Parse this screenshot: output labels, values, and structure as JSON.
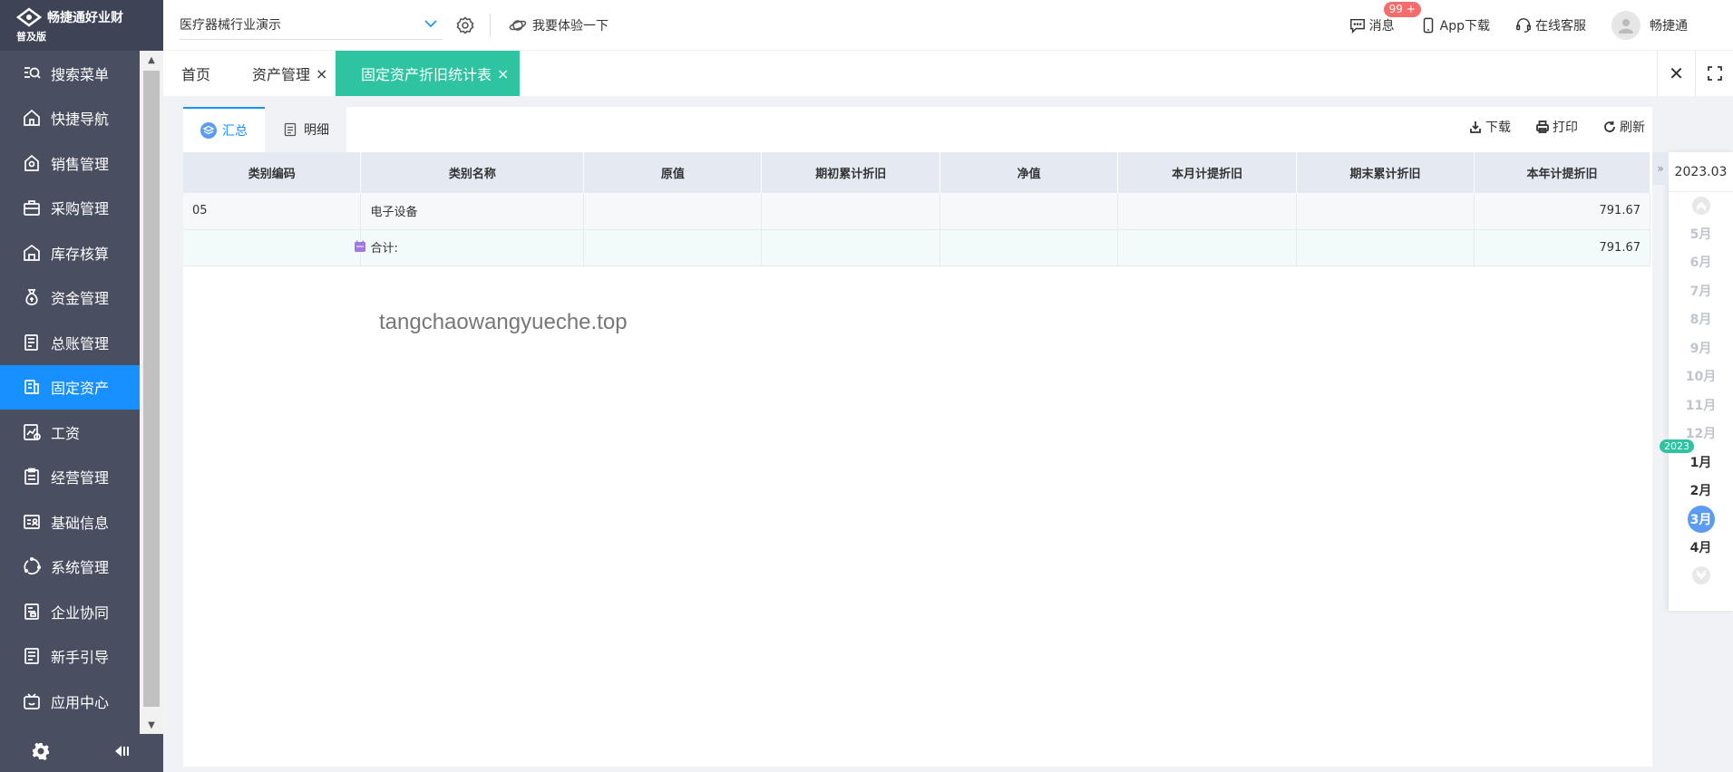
{
  "sidebar": {
    "brand": "畅捷通好业财",
    "edition": "普及版",
    "items": [
      {
        "label": "搜索菜单",
        "icon": "search-menu-icon"
      },
      {
        "label": "快捷导航",
        "icon": "home-icon"
      },
      {
        "label": "销售管理",
        "icon": "sales-icon"
      },
      {
        "label": "采购管理",
        "icon": "purchase-icon"
      },
      {
        "label": "库存核算",
        "icon": "warehouse-icon"
      },
      {
        "label": "资金管理",
        "icon": "money-bag-icon"
      },
      {
        "label": "总账管理",
        "icon": "ledger-icon"
      },
      {
        "label": "固定资产",
        "icon": "fixed-asset-icon"
      },
      {
        "label": "工资",
        "icon": "salary-icon"
      },
      {
        "label": "经营管理",
        "icon": "clipboard-icon"
      },
      {
        "label": "基础信息",
        "icon": "id-card-icon"
      },
      {
        "label": "系统管理",
        "icon": "system-icon"
      },
      {
        "label": "企业协同",
        "icon": "collaboration-icon"
      },
      {
        "label": "新手引导",
        "icon": "guide-icon"
      },
      {
        "label": "应用中心",
        "icon": "app-center-icon"
      }
    ],
    "active_index": 7
  },
  "header": {
    "company": "医疗器械行业演示",
    "try_label": "我要体验一下",
    "messages_label": "消息",
    "messages_badge": "99 +",
    "app_download": "App下载",
    "online_service": "在线客服",
    "username": "畅捷通"
  },
  "tabs": [
    {
      "label": "首页",
      "closable": false
    },
    {
      "label": "资产管理",
      "closable": true
    },
    {
      "label": "固定资产折旧统计表",
      "closable": true,
      "active": true
    }
  ],
  "subtabs": [
    {
      "label": "汇总",
      "active": true
    },
    {
      "label": "明细",
      "active": false
    }
  ],
  "toolbar": {
    "download": "下载",
    "print": "打印",
    "refresh": "刷新"
  },
  "table": {
    "columns": [
      "类别编码",
      "类别名称",
      "原值",
      "期初累计折旧",
      "净值",
      "本月计提折旧",
      "期末累计折旧",
      "本年计提折旧"
    ],
    "rows": [
      {
        "code": "05",
        "name": "电子设备",
        "original": "",
        "opening_dep": "",
        "net": "",
        "month_dep": "",
        "closing_dep": "",
        "year_dep": "791.67"
      }
    ],
    "total": {
      "label": "合计:",
      "year_dep": "791.67"
    }
  },
  "watermark": "tangchaowangyueche.top",
  "period": {
    "current": "2023.03",
    "year_tag": "2023",
    "months": [
      "5月",
      "6月",
      "7月",
      "8月",
      "9月",
      "10月",
      "11月",
      "12月",
      "1月",
      "2月",
      "3月",
      "4月"
    ],
    "selected": "3月"
  },
  "colors": {
    "sidebar_bg": "#4a4e61",
    "active_menu": "#1890ff",
    "active_tab": "#2ec4a2",
    "badge": "#f56c6c",
    "selected_month": "#5b9cf2"
  }
}
